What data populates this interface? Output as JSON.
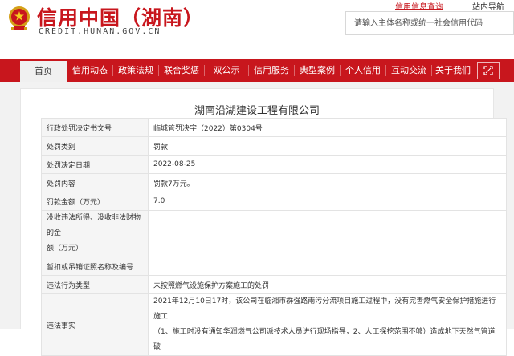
{
  "header": {
    "title": "信用中国（湖南）",
    "url": "CREDIT.HUNAN.GOV.CN",
    "link_app": "信用信息查询",
    "link_nav": "站内导航",
    "search_placeholder": "请输入主体名称或统一社会信用代码"
  },
  "nav": {
    "items": [
      {
        "label": "首页",
        "active": true
      },
      {
        "label": "信用动态"
      },
      {
        "label": "政策法规"
      },
      {
        "label": "联合奖惩"
      },
      {
        "label": "双公示"
      },
      {
        "label": "信用服务"
      },
      {
        "label": "典型案例"
      },
      {
        "label": "个人信用"
      },
      {
        "label": "互动交流"
      },
      {
        "label": "关于我们"
      }
    ],
    "icon": "expand-icon"
  },
  "record": {
    "company": "湖南沿湖建设工程有限公司",
    "rows": [
      {
        "label": "行政处罚决定书文号",
        "value": "临城管罚决字（2022）第0304号"
      },
      {
        "label": "处罚类别",
        "value": "罚款"
      },
      {
        "label": "处罚决定日期",
        "value": "2022-08-25"
      },
      {
        "label": "处罚内容",
        "value": "罚款7万元。"
      },
      {
        "label": "罚款金额（万元）",
        "value": "7.0"
      },
      {
        "label_lines": [
          "没收违法所得、没收非法财物的金",
          "额（万元）"
        ],
        "value": ""
      },
      {
        "label": "暂扣或吊销证照名称及编号",
        "value": ""
      },
      {
        "label": "违法行为类型",
        "value": "未按照燃气设施保护方案施工的处罚"
      },
      {
        "label": "违法事实",
        "value_lines": [
          "2021年12月10日17时，该公司在临湘市群强路雨污分流项目施工过程中，没有完善燃气安全保护措施进行施工",
          "（1、施工时没有通知华润燃气公司派技术人员进行现场指导，2、人工探挖范围不够）造成地下天然气管道破"
        ]
      }
    ]
  }
}
